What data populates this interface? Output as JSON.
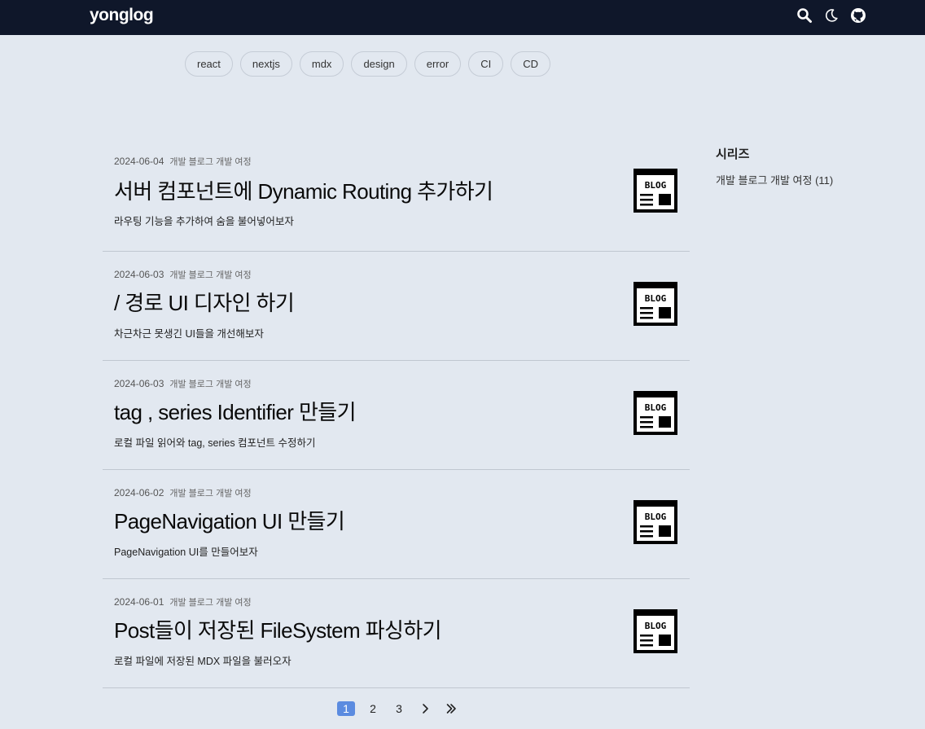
{
  "header": {
    "logo": "yonglog"
  },
  "icons": {
    "search": "search-icon",
    "theme": "moon-icon",
    "github": "github-icon"
  },
  "tags": [
    "react",
    "nextjs",
    "mdx",
    "design",
    "error",
    "CI",
    "CD"
  ],
  "posts": [
    {
      "date": "2024-06-04",
      "series": "개발 블로그 개발 여정",
      "title": "서버 컴포넌트에 Dynamic Routing 추가하기",
      "desc": "라우팅 기능을 추가하여 숨을 불어넣어보자",
      "thumb_text": "BLOG"
    },
    {
      "date": "2024-06-03",
      "series": "개발 블로그 개발 여정",
      "title": "/ 경로 UI 디자인 하기",
      "desc": "차근차근 못생긴 UI들을 개선해보자",
      "thumb_text": "BLOG"
    },
    {
      "date": "2024-06-03",
      "series": "개발 블로그 개발 여정",
      "title": "tag , series Identifier 만들기",
      "desc": "로컬 파일 읽어와 tag, series 컴포넌트 수정하기",
      "thumb_text": "BLOG"
    },
    {
      "date": "2024-06-02",
      "series": "개발 블로그 개발 여정",
      "title": "PageNavigation UI 만들기",
      "desc": "PageNavigation UI를 만들어보자",
      "thumb_text": "BLOG"
    },
    {
      "date": "2024-06-01",
      "series": "개발 블로그 개발 여정",
      "title": "Post들이 저장된 FileSystem 파싱하기",
      "desc": "로컬 파일에 저장된 MDX 파일을 불러오자",
      "thumb_text": "BLOG"
    }
  ],
  "sidebar": {
    "heading": "시리즈",
    "items": [
      "개발 블로그 개발 여정 (11)"
    ]
  },
  "pagination": {
    "pages": [
      "1",
      "2",
      "3"
    ],
    "current": "1"
  },
  "colors": {
    "header_bg": "#0f172a",
    "page_bg": "#e2e8f0",
    "active_page": "#5b8be0"
  }
}
